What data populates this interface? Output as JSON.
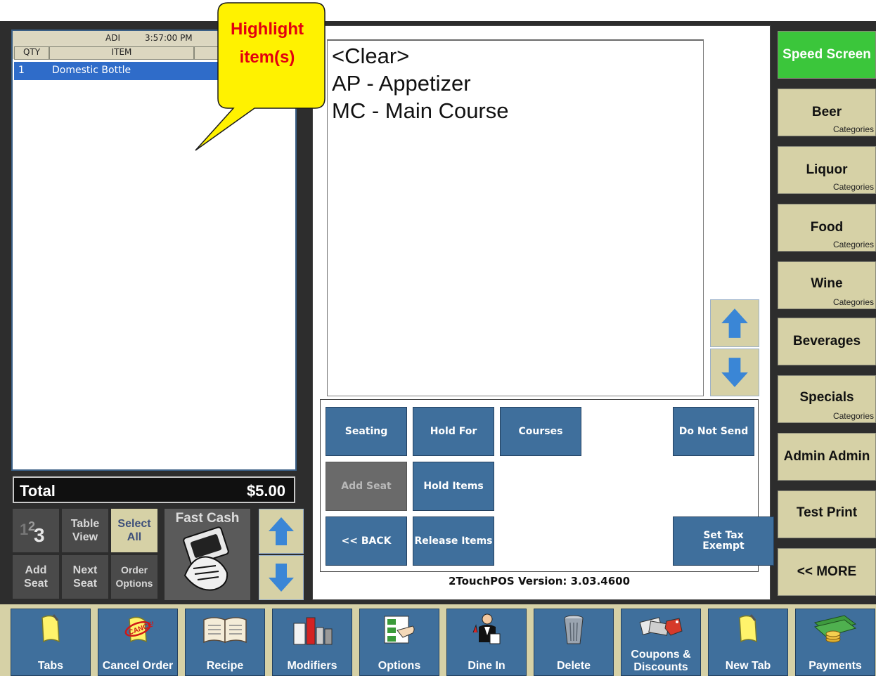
{
  "order": {
    "header_user": "ADI",
    "header_time": "3:57:00 PM",
    "col_qty": "QTY",
    "col_item": "ITEM",
    "rows": [
      {
        "qty": "1",
        "item": "Domestic Bottle"
      }
    ],
    "total_label": "Total",
    "total_value": "$5.00"
  },
  "callout": {
    "line1": "Highlight",
    "line2": "item(s)"
  },
  "order_controls": {
    "numpad_label": "123",
    "table_view": "Table View",
    "select_all": "Select All",
    "fast_cash": "Fast Cash",
    "add_seat": "Add Seat",
    "next_seat": "Next Seat",
    "order_options": "Order Options"
  },
  "courses": [
    "<Clear>",
    "AP - Appetizer",
    "MC - Main Course"
  ],
  "actions": {
    "seating": "Seating",
    "hold_for": "Hold For",
    "courses": "Courses",
    "do_not_send": "Do Not Send",
    "add_seat": "Add Seat",
    "hold_items": "Hold Items",
    "back": "<< BACK",
    "release_items": "Release Items",
    "set_tax_exempt": "Set Tax Exempt"
  },
  "version": "2TouchPOS Version: 3.03.4600",
  "right_menu": [
    {
      "label": "Speed Screen",
      "sub": ""
    },
    {
      "label": "Beer",
      "sub": "Categories"
    },
    {
      "label": "Liquor",
      "sub": "Categories"
    },
    {
      "label": "Food",
      "sub": "Categories"
    },
    {
      "label": "Wine",
      "sub": "Categories"
    },
    {
      "label": "Beverages",
      "sub": ""
    },
    {
      "label": "Specials",
      "sub": "Categories"
    },
    {
      "label": "Admin Admin",
      "sub": ""
    },
    {
      "label": "Test Print",
      "sub": ""
    },
    {
      "label": "<< MORE",
      "sub": ""
    }
  ],
  "toolbar": [
    {
      "label": "Tabs",
      "icon": "note-icon"
    },
    {
      "label": "Cancel Order",
      "icon": "cancel-stamp-icon"
    },
    {
      "label": "Recipe",
      "icon": "book-icon"
    },
    {
      "label": "Modifiers",
      "icon": "condiments-icon"
    },
    {
      "label": "Options",
      "icon": "pointing-hand-icon"
    },
    {
      "label": "Dine In",
      "icon": "waiter-icon"
    },
    {
      "label": "Delete",
      "icon": "trash-can-icon"
    },
    {
      "label": "Coupons & Discounts",
      "icon": "coupon-tag-icon"
    },
    {
      "label": "New Tab",
      "icon": "note-icon"
    },
    {
      "label": "Payments",
      "icon": "money-icon"
    }
  ],
  "colors": {
    "speed_screen": "#3bc63b",
    "tan": "#d6d1a6",
    "blue_button": "#3f6f9c",
    "selected_row": "#2f6cc9",
    "callout_fill": "#fff200",
    "callout_text": "#e3000f"
  }
}
